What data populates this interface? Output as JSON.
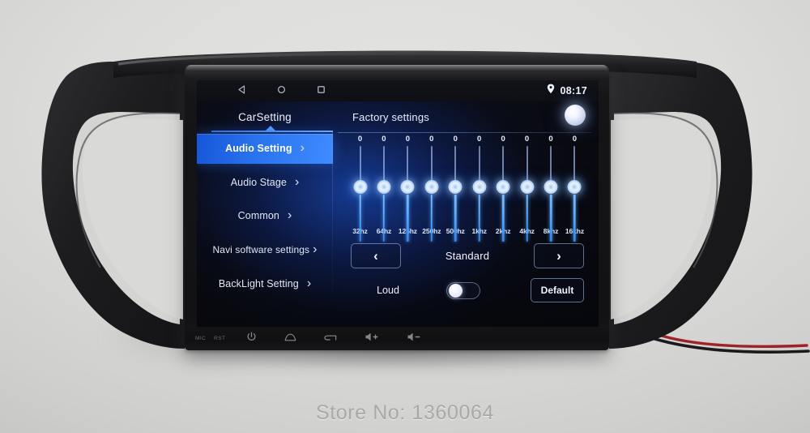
{
  "scene": {
    "watermark": "Store No: 1360064"
  },
  "statusbar": {
    "back_icon": "back-triangle-icon",
    "home_icon": "home-circle-icon",
    "recents_icon": "recents-square-icon",
    "location_icon": "location-pin-icon",
    "clock": "08:17"
  },
  "header": {
    "left_title": "CarSetting",
    "right_title": "Factory settings",
    "knob_icon": "indicator-dot-icon"
  },
  "sidebar": {
    "items": [
      {
        "label": "Audio Setting",
        "chevron": "›",
        "selected": true
      },
      {
        "label": "Audio Stage",
        "chevron": "›",
        "selected": false
      },
      {
        "label": "Common",
        "chevron": "›",
        "selected": false
      },
      {
        "label": "Navi software settings",
        "chevron": "›",
        "selected": false
      },
      {
        "label": "BackLight Setting",
        "chevron": "›",
        "selected": false
      }
    ]
  },
  "equalizer": {
    "bands": [
      {
        "label": "32hz",
        "value": "0"
      },
      {
        "label": "64hz",
        "value": "0"
      },
      {
        "label": "125hz",
        "value": "0"
      },
      {
        "label": "250hz",
        "value": "0"
      },
      {
        "label": "500hz",
        "value": "0"
      },
      {
        "label": "1khz",
        "value": "0"
      },
      {
        "label": "2khz",
        "value": "0"
      },
      {
        "label": "4khz",
        "value": "0"
      },
      {
        "label": "8khz",
        "value": "0"
      },
      {
        "label": "16khz",
        "value": "0"
      }
    ],
    "preset": {
      "prev_label": "‹",
      "name": "Standard",
      "next_label": "›"
    },
    "loud": {
      "label": "Loud",
      "state": "off"
    },
    "default_button": "Default"
  },
  "hardware_buttons": {
    "mic_label": "MIC",
    "rst_label": "RST",
    "icons": [
      "power-icon",
      "home-icon",
      "back-arrow-icon",
      "volume-up-icon",
      "volume-down-icon"
    ]
  },
  "colors": {
    "accent_blue": "#2a74ef",
    "slider_blue": "#4ea4ff",
    "screen_bg": "#06070b",
    "bezel_black": "#18181a",
    "wire_red": "#9e2326"
  }
}
